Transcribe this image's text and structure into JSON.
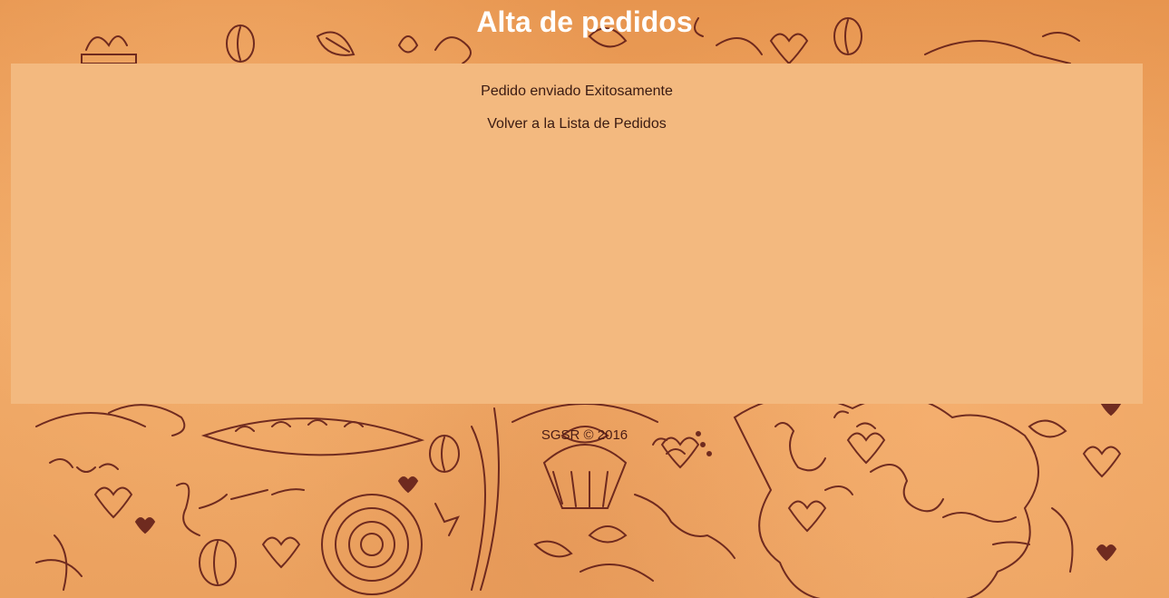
{
  "header": {
    "title": "Alta de pedidos"
  },
  "main": {
    "message": "Pedido enviado Exitosamente",
    "back_link": "Volver a la Lista de Pedidos"
  },
  "footer": {
    "text": "SGSR © 2016"
  },
  "colors": {
    "background": "#ec9f5c",
    "panel": "#f3b97f",
    "text": "#3a1a12",
    "doodle": "#5a1614"
  }
}
